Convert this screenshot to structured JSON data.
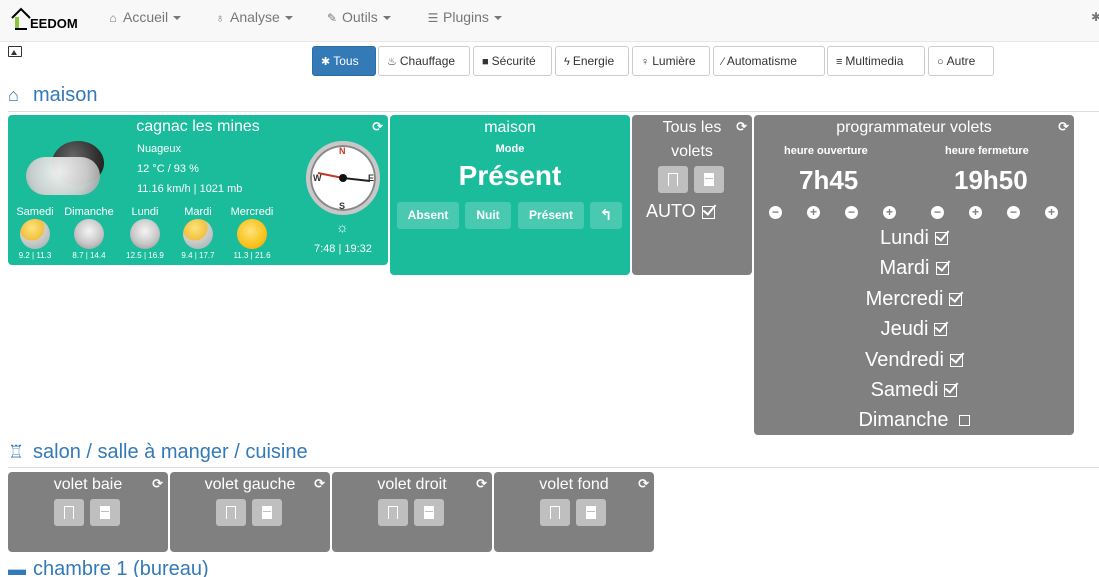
{
  "app": {
    "logo_text": "EEDOM"
  },
  "nav": {
    "items": [
      {
        "label": "Accueil",
        "icon": "home-icon"
      },
      {
        "label": "Analyse",
        "icon": "stethoscope-icon"
      },
      {
        "label": "Outils",
        "icon": "wrench-icon"
      },
      {
        "label": "Plugins",
        "icon": "list-icon"
      }
    ]
  },
  "filters": [
    {
      "label": "Tous",
      "icon": "asterisk-icon",
      "active": true
    },
    {
      "label": "Chauffage",
      "icon": "fire-icon"
    },
    {
      "label": "Sécurité",
      "icon": "lock-icon"
    },
    {
      "label": "Energie",
      "icon": "bolt-icon"
    },
    {
      "label": "Lumière",
      "icon": "bulb-icon"
    },
    {
      "label": "Automatisme",
      "icon": "magic-icon"
    },
    {
      "label": "Multimedia",
      "icon": "sliders-icon"
    },
    {
      "label": "Autre",
      "icon": "circle-icon"
    }
  ],
  "sections": {
    "maison": "maison",
    "salon": "salon / salle à manger / cuisine",
    "chambre": "chambre 1 (bureau)"
  },
  "weather": {
    "title": "cagnac les mines",
    "condition": "Nuageux",
    "temp_humidity": "12 °C / 93 %",
    "wind_pressure": "11.16 km/h | 1021 mb",
    "sun_times": "7:48 | 19:32",
    "compass": {
      "n": "N",
      "s": "S",
      "e": "E",
      "w": "W"
    },
    "forecast": [
      {
        "day": "Samedi",
        "temps": "9.2 | 11.3",
        "icon": "cloudy-sun-icon"
      },
      {
        "day": "Dimanche",
        "temps": "8.7 | 14.4",
        "icon": "cloud-icon"
      },
      {
        "day": "Lundi",
        "temps": "12.5 | 16.9",
        "icon": "cloud-icon"
      },
      {
        "day": "Mardi",
        "temps": "9.4 | 17.7",
        "icon": "cloudy-sun-icon"
      },
      {
        "day": "Mercredi",
        "temps": "11.3 | 21.6",
        "icon": "sun-icon"
      }
    ]
  },
  "mode": {
    "title": "maison",
    "label": "Mode",
    "value": "Présent",
    "buttons": [
      "Absent",
      "Nuit",
      "Présent"
    ]
  },
  "all_shutters": {
    "title_line1": "Tous les",
    "title_line2": "volets",
    "auto_label": "AUTO"
  },
  "programmer": {
    "title": "programmateur volets",
    "open_label": "heure ouverture",
    "close_label": "heure fermeture",
    "open_time": "7h45",
    "close_time": "19h50",
    "minus": "−",
    "plus": "+",
    "days": [
      {
        "name": "Lundi",
        "checked": true
      },
      {
        "name": "Mardi",
        "checked": true
      },
      {
        "name": "Mercredi",
        "checked": true
      },
      {
        "name": "Jeudi",
        "checked": true
      },
      {
        "name": "Vendredi",
        "checked": true
      },
      {
        "name": "Samedi",
        "checked": true
      },
      {
        "name": "Dimanche",
        "checked": false
      }
    ]
  },
  "shutters": [
    {
      "name": "volet baie"
    },
    {
      "name": "volet gauche"
    },
    {
      "name": "volet droit"
    },
    {
      "name": "volet fond"
    }
  ],
  "colors": {
    "green": "#1abc9c",
    "gray": "#808080",
    "accent": "#337ab7"
  }
}
